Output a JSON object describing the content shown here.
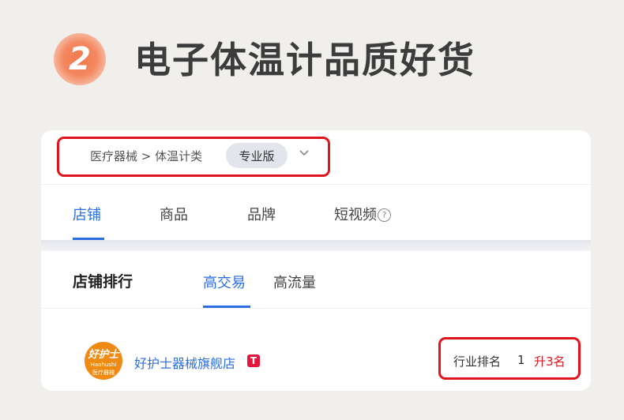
{
  "header": {
    "step_number": "2",
    "title": "电子体温计品质好货"
  },
  "breadcrumb": {
    "path": "医疗器械 > 体温计类",
    "edition_badge": "专业版"
  },
  "tabs": [
    {
      "label": "店铺",
      "active": true
    },
    {
      "label": "商品",
      "active": false
    },
    {
      "label": "品牌",
      "active": false
    },
    {
      "label": "短视频",
      "active": false,
      "icon": "help-icon"
    }
  ],
  "ranking": {
    "title": "店铺排行",
    "subtabs": [
      {
        "label": "高交易",
        "active": true
      },
      {
        "label": "高流量",
        "active": false
      }
    ]
  },
  "store": {
    "logo_text": "好护士",
    "logo_sub": "Haohushi",
    "logo_sub2": "医疗器械",
    "name": "好护士器械旗舰店",
    "tag": "T",
    "rank_label": "行业排名",
    "rank_value": "1",
    "rank_change": "升3名"
  },
  "colors": {
    "accent": "#2c6fe0",
    "highlight": "#e0141c",
    "badge": "#f07a4e"
  }
}
